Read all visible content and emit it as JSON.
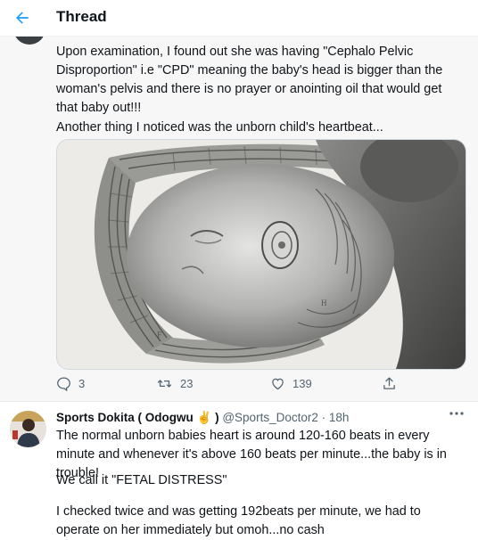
{
  "header": {
    "title": "Thread"
  },
  "tweet1": {
    "paragraphs": [
      "Upon examination, I found out she was having \"Cephalo Pelvic Disproportion\" i.e \"CPD\" meaning the baby's head is bigger than the woman's pelvis and there is no prayer or anointing oil that would get that baby out!!!",
      "Another thing I noticed was the unborn child's heartbeat..."
    ],
    "replies": "3",
    "retweets": "23",
    "likes": "139"
  },
  "tweet2": {
    "name": "Sports Dokita ( Odogwu",
    "name_emoji": "✌",
    "name_close": " )",
    "handle": "@Sports_Doctor2",
    "separator": "·",
    "time": "18h",
    "paragraphs": [
      "The normal unborn babies heart is around 120-160 beats in every minute and whenever it's above 160 beats per minute...the baby is in trouble!",
      "We call it \"FETAL DISTRESS\"",
      "I checked twice and was getting 192beats per minute, we had to operate on her immediately but omoh...no cash"
    ]
  },
  "colors": {
    "accent": "#1d9bf0",
    "secondary_text": "#536471",
    "thread_bg": "#f7f7f7"
  },
  "icons": [
    "back-arrow-icon",
    "reply-icon",
    "retweet-icon",
    "like-icon",
    "share-icon",
    "more-icon",
    "victory-hand-emoji"
  ]
}
